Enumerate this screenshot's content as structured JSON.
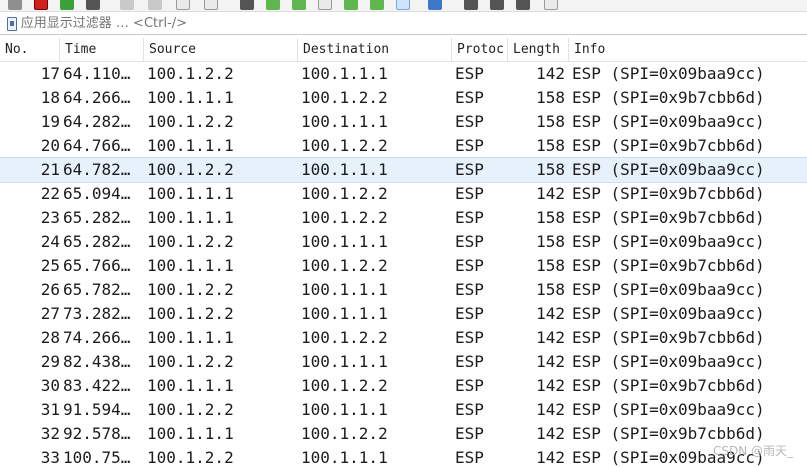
{
  "filter": {
    "placeholder": "应用显示过滤器 … <Ctrl-/>"
  },
  "columns": {
    "no": "No.",
    "time": "Time",
    "source": "Source",
    "destination": "Destination",
    "protocol": "Protoc",
    "length": "Length",
    "info": "Info"
  },
  "packets": [
    {
      "no": "17",
      "time": "64.110…",
      "source": "100.1.2.2",
      "destination": "100.1.1.1",
      "protocol": "ESP",
      "length": "142",
      "info": "ESP (SPI=0x09baa9cc)"
    },
    {
      "no": "18",
      "time": "64.266…",
      "source": "100.1.1.1",
      "destination": "100.1.2.2",
      "protocol": "ESP",
      "length": "158",
      "info": "ESP (SPI=0x9b7cbb6d)"
    },
    {
      "no": "19",
      "time": "64.282…",
      "source": "100.1.2.2",
      "destination": "100.1.1.1",
      "protocol": "ESP",
      "length": "158",
      "info": "ESP (SPI=0x09baa9cc)"
    },
    {
      "no": "20",
      "time": "64.766…",
      "source": "100.1.1.1",
      "destination": "100.1.2.2",
      "protocol": "ESP",
      "length": "158",
      "info": "ESP (SPI=0x9b7cbb6d)"
    },
    {
      "no": "21",
      "time": "64.782…",
      "source": "100.1.2.2",
      "destination": "100.1.1.1",
      "protocol": "ESP",
      "length": "158",
      "info": "ESP (SPI=0x09baa9cc)",
      "selected": true
    },
    {
      "no": "22",
      "time": "65.094…",
      "source": "100.1.1.1",
      "destination": "100.1.2.2",
      "protocol": "ESP",
      "length": "142",
      "info": "ESP (SPI=0x9b7cbb6d)"
    },
    {
      "no": "23",
      "time": "65.282…",
      "source": "100.1.1.1",
      "destination": "100.1.2.2",
      "protocol": "ESP",
      "length": "158",
      "info": "ESP (SPI=0x9b7cbb6d)"
    },
    {
      "no": "24",
      "time": "65.282…",
      "source": "100.1.2.2",
      "destination": "100.1.1.1",
      "protocol": "ESP",
      "length": "158",
      "info": "ESP (SPI=0x09baa9cc)"
    },
    {
      "no": "25",
      "time": "65.766…",
      "source": "100.1.1.1",
      "destination": "100.1.2.2",
      "protocol": "ESP",
      "length": "158",
      "info": "ESP (SPI=0x9b7cbb6d)"
    },
    {
      "no": "26",
      "time": "65.782…",
      "source": "100.1.2.2",
      "destination": "100.1.1.1",
      "protocol": "ESP",
      "length": "158",
      "info": "ESP (SPI=0x09baa9cc)"
    },
    {
      "no": "27",
      "time": "73.282…",
      "source": "100.1.2.2",
      "destination": "100.1.1.1",
      "protocol": "ESP",
      "length": "142",
      "info": "ESP (SPI=0x09baa9cc)"
    },
    {
      "no": "28",
      "time": "74.266…",
      "source": "100.1.1.1",
      "destination": "100.1.2.2",
      "protocol": "ESP",
      "length": "142",
      "info": "ESP (SPI=0x9b7cbb6d)"
    },
    {
      "no": "29",
      "time": "82.438…",
      "source": "100.1.2.2",
      "destination": "100.1.1.1",
      "protocol": "ESP",
      "length": "142",
      "info": "ESP (SPI=0x09baa9cc)"
    },
    {
      "no": "30",
      "time": "83.422…",
      "source": "100.1.1.1",
      "destination": "100.1.2.2",
      "protocol": "ESP",
      "length": "142",
      "info": "ESP (SPI=0x9b7cbb6d)"
    },
    {
      "no": "31",
      "time": "91.594…",
      "source": "100.1.2.2",
      "destination": "100.1.1.1",
      "protocol": "ESP",
      "length": "142",
      "info": "ESP (SPI=0x09baa9cc)"
    },
    {
      "no": "32",
      "time": "92.578…",
      "source": "100.1.1.1",
      "destination": "100.1.2.2",
      "protocol": "ESP",
      "length": "142",
      "info": "ESP (SPI=0x9b7cbb6d)"
    },
    {
      "no": "33",
      "time": "100.75…",
      "source": "100.1.2.2",
      "destination": "100.1.1.1",
      "protocol": "ESP",
      "length": "142",
      "info": "ESP (SPI=0x09baa9cc)"
    }
  ],
  "watermark": "CSDN @雨天_"
}
